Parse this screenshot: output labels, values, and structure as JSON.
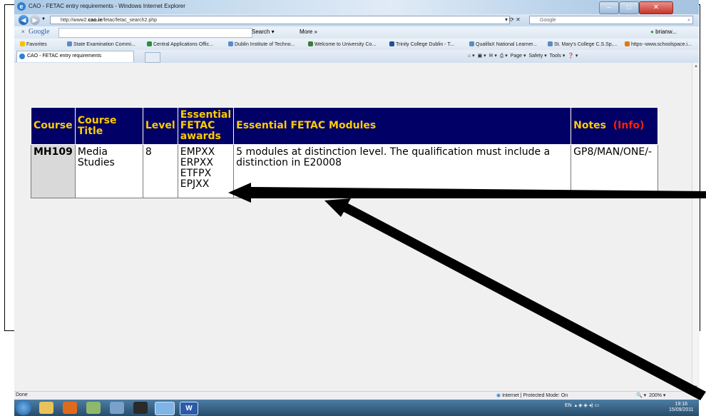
{
  "window": {
    "title": "CAO - FETAC entry requirements - Windows Internet Explorer",
    "url_prefix": "http://www2.",
    "url_domain": "cao.ie",
    "url_path": "/fetac/fetac_search2.php",
    "search_provider": "Google"
  },
  "google_toolbar": {
    "close": "×",
    "logo": "Google",
    "search_label": "Search",
    "more_label": "More »",
    "user_label": "brianw..."
  },
  "favorites": {
    "label": "Favorites",
    "items": [
      "State Examination Commi...",
      "Central Applications Offic...",
      "Dublin Institute of Techno...",
      "Welcome to University Co...",
      "Trinity College Dublin - T...",
      "QualifaX National Learner...",
      "St. Mary's College C.S.Sp,...",
      "https--www.schoolspace.i..."
    ]
  },
  "tab": {
    "label": "CAO - FETAC entry requirements"
  },
  "command_bar": {
    "page": "Page",
    "safety": "Safety",
    "tools": "Tools"
  },
  "table": {
    "headers": {
      "course": "Course",
      "course_title_1": "Course",
      "course_title_2": "Title",
      "level": "Level",
      "awards_1": "Essential",
      "awards_2": "FETAC",
      "awards_3": "awards",
      "modules": "Essential FETAC Modules",
      "notes": "Notes",
      "info": "(Info)"
    },
    "row": {
      "code": "MH109",
      "title_1": "Media",
      "title_2": "Studies",
      "level": "8",
      "awards": [
        "EMPXX",
        "ERPXX",
        "ETFPX",
        "EPJXX"
      ],
      "modules": "5 modules at distinction level. The qualification must include a distinction in E20008",
      "notes": "GP8/MAN/ONE/-"
    }
  },
  "status_bar": {
    "left": "Done",
    "zone": "Internet | Protected Mode: On",
    "zoom": "200%"
  },
  "taskbar": {
    "lang": "EN",
    "time": "19:16",
    "date": "15/09/2011"
  }
}
